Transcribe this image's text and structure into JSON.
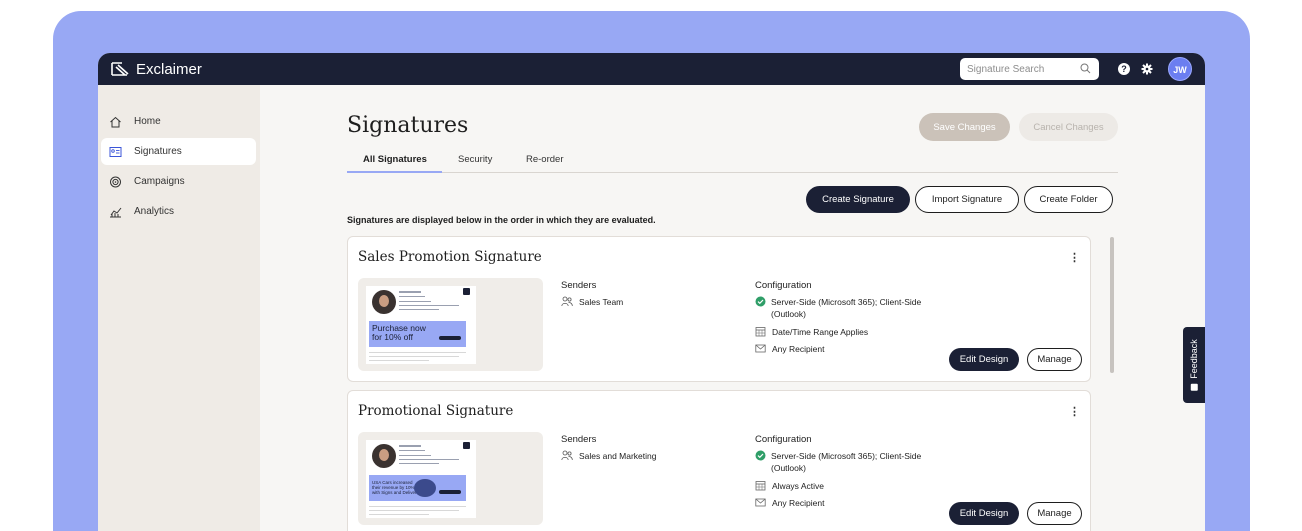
{
  "header": {
    "app_name": "Exclaimer",
    "search_placeholder": "Signature Search",
    "help_label": "?",
    "avatar_initials": "JW"
  },
  "sidebar": {
    "items": [
      {
        "label": "Home",
        "icon": "home-icon"
      },
      {
        "label": "Signatures",
        "icon": "signature-card-icon",
        "active": true
      },
      {
        "label": "Campaigns",
        "icon": "target-icon"
      },
      {
        "label": "Analytics",
        "icon": "analytics-chart-icon"
      }
    ]
  },
  "main": {
    "title": "Signatures",
    "save_label": "Save Changes",
    "cancel_label": "Cancel Changes",
    "tabs": [
      {
        "label": "All Signatures",
        "active": true
      },
      {
        "label": "Security"
      },
      {
        "label": "Re-order"
      }
    ],
    "actions": {
      "create": "Create Signature",
      "import": "Import Signature",
      "folder": "Create Folder"
    },
    "order_note": "Signatures are displayed below in the order in which they are evaluated.",
    "senders_heading": "Senders",
    "config_heading": "Configuration",
    "edit_label": "Edit Design",
    "manage_label": "Manage",
    "cards": [
      {
        "title": "Sales Promotion Signature",
        "sender": "Sales Team",
        "config_1": "Server-Side (Microsoft 365); Client-Side",
        "config_1b": "(Outlook)",
        "config_2": "Date/Time Range Applies",
        "config_3": "Any Recipient",
        "banner_text": "Purchase now\nfor 10% off"
      },
      {
        "title": "Promotional Signature",
        "sender": "Sales and Marketing",
        "config_1": "Server-Side (Microsoft 365); Client-Side",
        "config_1b": "(Outlook)",
        "config_2": "Always Active",
        "config_3": "Any Recipient",
        "banner_text": "USA Cars increased\ntheir revenue by 10%\nwith Signs and Deliver"
      }
    ]
  },
  "feedback_label": "Feedback",
  "colors": {
    "frame": "#98a8f4",
    "topbar": "#1b2035",
    "sidebar": "#efebe6",
    "accent": "#98a8f4",
    "success": "#2f9e68"
  }
}
